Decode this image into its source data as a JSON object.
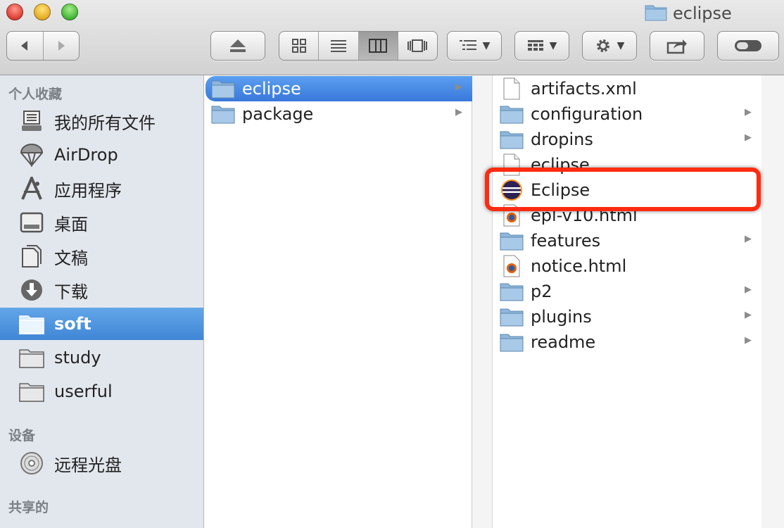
{
  "window": {
    "title": "eclipse"
  },
  "sidebar": {
    "sections": {
      "favorites": "个人收藏",
      "devices": "设备",
      "shared": "共享的"
    },
    "favorites": [
      {
        "label": "我的所有文件",
        "icon": "all-files-icon"
      },
      {
        "label": "AirDrop",
        "icon": "airdrop-icon"
      },
      {
        "label": "应用程序",
        "icon": "applications-icon"
      },
      {
        "label": "桌面",
        "icon": "desktop-icon"
      },
      {
        "label": "文稿",
        "icon": "documents-icon"
      },
      {
        "label": "下载",
        "icon": "downloads-icon"
      },
      {
        "label": "soft",
        "icon": "folder-icon",
        "selected": true
      },
      {
        "label": "study",
        "icon": "folder-icon"
      },
      {
        "label": "userful",
        "icon": "folder-icon"
      }
    ],
    "devices": [
      {
        "label": "远程光盘",
        "icon": "disc-icon"
      }
    ]
  },
  "column1": [
    {
      "label": "eclipse",
      "type": "folder",
      "selected": true
    },
    {
      "label": "package",
      "type": "folder"
    }
  ],
  "column2": [
    {
      "label": "artifacts.xml",
      "type": "file"
    },
    {
      "label": "configuration",
      "type": "folder"
    },
    {
      "label": "dropins",
      "type": "folder"
    },
    {
      "label": "eclipse",
      "type": "file"
    },
    {
      "label": "Eclipse",
      "type": "app"
    },
    {
      "label": "epl-v10.html",
      "type": "html"
    },
    {
      "label": "features",
      "type": "folder"
    },
    {
      "label": "notice.html",
      "type": "html"
    },
    {
      "label": "p2",
      "type": "folder"
    },
    {
      "label": "plugins",
      "type": "folder"
    },
    {
      "label": "readme",
      "type": "folder"
    }
  ],
  "colors": {
    "selection": "#3a78db",
    "sidebar_bg": "#e2e7ed",
    "highlight": "#ff2b10"
  }
}
